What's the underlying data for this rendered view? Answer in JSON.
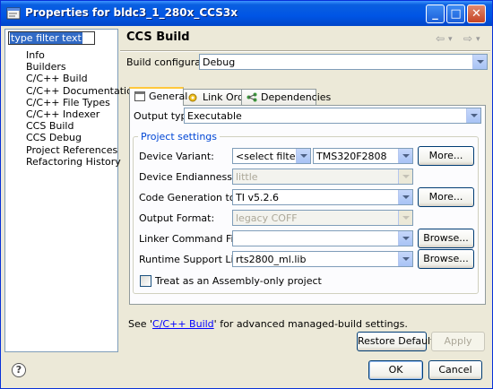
{
  "window": {
    "title": "Properties for bldc3_1_280x_CCS3x",
    "controls": {
      "minimize": "_",
      "maximize": "□",
      "close": "✕"
    }
  },
  "left_panel": {
    "filter_placeholder": "type filter text",
    "tree": [
      "Info",
      "Builders",
      "C/C++ Build",
      "C/C++ Documentation",
      "C/C++ File Types",
      "C/C++ Indexer",
      "CCS Build",
      "CCS Debug",
      "Project References",
      "Refactoring History"
    ]
  },
  "page": {
    "title": "CCS Build",
    "nav_back": "⇦",
    "nav_forward": "⇨",
    "nav_dropdown": "▾",
    "build_config_label": "Build configuration:",
    "build_config_value": "Debug",
    "tabs": [
      {
        "label": "General",
        "icon": "general-tab-icon"
      },
      {
        "label": "Link Order",
        "icon": "link-order-icon"
      },
      {
        "label": "Dependencies",
        "icon": "dependencies-icon"
      }
    ],
    "output_type_label": "Output type:",
    "output_type_value": "Executable",
    "project_settings": {
      "title": "Project settings",
      "device_variant_label": "Device Variant:",
      "device_filter_value": "<select filter>",
      "device_value": "TMS320F2808",
      "device_more": "More...",
      "endianness_label": "Device Endianness:",
      "endianness_value": "little",
      "codegen_label": "Code Generation tools:",
      "codegen_value": "TI v5.2.6",
      "codegen_more": "More...",
      "output_format_label": "Output Format:",
      "output_format_value": "legacy COFF",
      "linker_label": "Linker Command File:",
      "linker_value": "",
      "linker_browse": "Browse...",
      "rts_label": "Runtime Support Library:",
      "rts_value": "rts2800_ml.lib",
      "rts_browse": "Browse...",
      "assembly_only_label": "Treat as an Assembly-only project",
      "assembly_only_checked": false
    },
    "see_prefix": "See '",
    "see_link": "C/C++ Build",
    "see_suffix": "' for advanced managed-build settings.",
    "restore_defaults": "Restore Defaults",
    "apply": "Apply"
  },
  "footer": {
    "help": "?",
    "ok": "OK",
    "cancel": "Cancel"
  },
  "colors": {
    "titlebar": "#0055e5",
    "selection": "#316ac5",
    "group_title": "#0046d5",
    "link": "#0000ff"
  }
}
